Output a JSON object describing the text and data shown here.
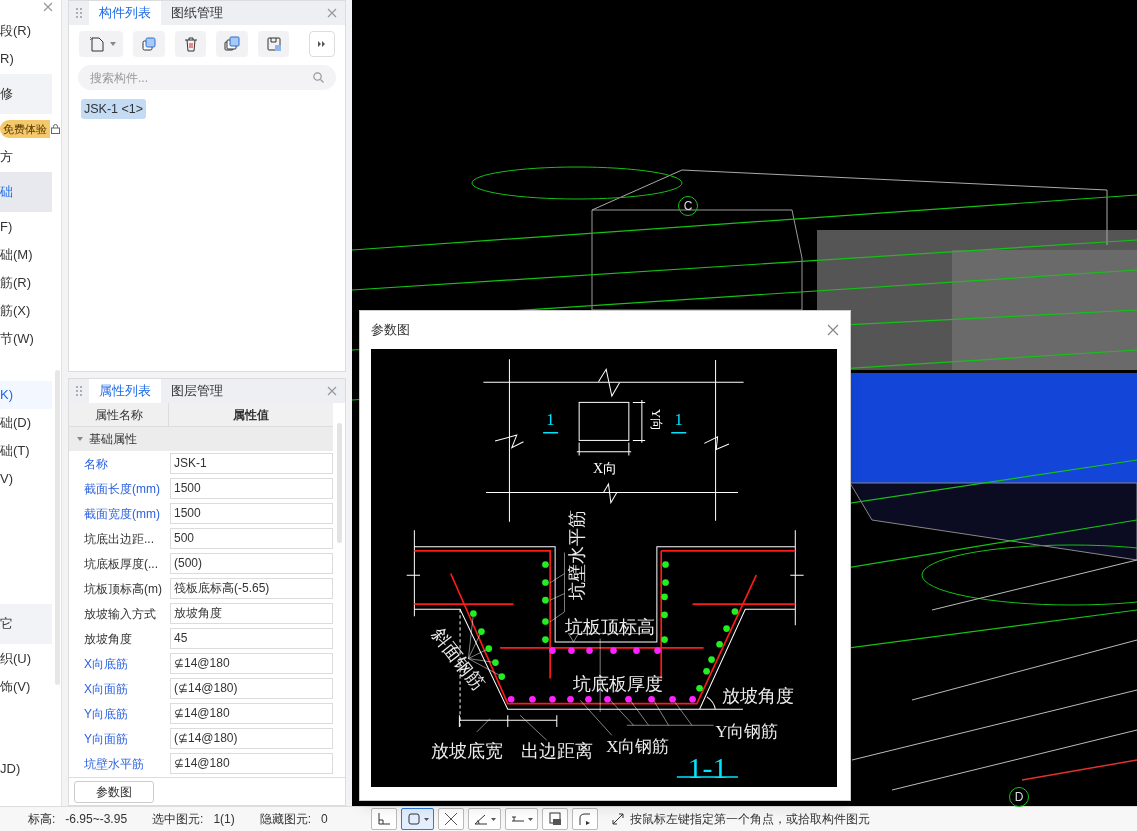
{
  "sidebar": {
    "trial_badge": "免费体验",
    "items": [
      {
        "label": "段(R)",
        "kind": "item",
        "selected": false
      },
      {
        "label": "R)",
        "kind": "item",
        "selected": false
      },
      {
        "label": "修",
        "kind": "group",
        "selected": false
      },
      {
        "label": "方",
        "kind": "item",
        "selected": false
      },
      {
        "label": "础",
        "kind": "group",
        "selected": true
      },
      {
        "label": "F)",
        "kind": "item",
        "selected": false
      },
      {
        "label": "础(M)",
        "kind": "item",
        "selected": false
      },
      {
        "label": "筋(R)",
        "kind": "item",
        "selected": false
      },
      {
        "label": "筋(X)",
        "kind": "item",
        "selected": false
      },
      {
        "label": "节(W)",
        "kind": "item",
        "selected": false
      },
      {
        "label": "K)",
        "kind": "item",
        "selected": true
      },
      {
        "label": "础(D)",
        "kind": "item",
        "selected": false
      },
      {
        "label": "础(T)",
        "kind": "item",
        "selected": false
      },
      {
        "label": "V)",
        "kind": "item",
        "selected": false
      },
      {
        "label": "它",
        "kind": "group",
        "selected": false
      },
      {
        "label": "织(U)",
        "kind": "item",
        "selected": false
      },
      {
        "label": "饰(V)",
        "kind": "item",
        "selected": false
      },
      {
        "label": "JD)",
        "kind": "item",
        "selected": false
      }
    ]
  },
  "component_panel": {
    "tabs": [
      {
        "label": "构件列表",
        "selected": true
      },
      {
        "label": "图纸管理",
        "selected": false
      }
    ],
    "search": {
      "placeholder": "搜索构件..."
    },
    "items": [
      {
        "label": "JSK-1 <1>",
        "selected": true
      }
    ]
  },
  "property_panel": {
    "tabs": [
      {
        "label": "属性列表",
        "selected": true
      },
      {
        "label": "图层管理",
        "selected": false
      }
    ],
    "columns": [
      "属性名称",
      "属性值"
    ],
    "groups": [
      {
        "label": "基础属性",
        "expanded": true,
        "rows": [
          {
            "name": "名称",
            "value": "JSK-1",
            "public": true
          },
          {
            "name": "截面长度(mm)",
            "value": "1500",
            "public": true
          },
          {
            "name": "截面宽度(mm)",
            "value": "1500",
            "public": true
          },
          {
            "name": "坑底出边距...",
            "value": "500",
            "public": false
          },
          {
            "name": "坑底板厚度(...",
            "value": "(500)",
            "public": false
          },
          {
            "name": "坑板顶标高(m)",
            "value": "筏板底标高(-5.65)",
            "public": false
          },
          {
            "name": "放坡输入方式",
            "value": "放坡角度",
            "public": false
          },
          {
            "name": "放坡角度",
            "value": "45",
            "public": false
          },
          {
            "name": "X向底筋",
            "value": "⊈14@180",
            "public": true
          },
          {
            "name": "X向面筋",
            "value": "(⊈14@180)",
            "public": true
          },
          {
            "name": "Y向底筋",
            "value": "⊈14@180",
            "public": true
          },
          {
            "name": "Y向面筋",
            "value": "(⊈14@180)",
            "public": true
          },
          {
            "name": "坑壁水平筋",
            "value": "⊈14@180",
            "public": true
          }
        ]
      }
    ],
    "button": "参数图"
  },
  "viewport": {
    "axis_labels": [
      "C",
      "D"
    ]
  },
  "dialog": {
    "title": "参数图",
    "plan": {
      "left_mark": "1",
      "right_mark": "1",
      "y_dim": "Y向",
      "x_dim": "X向"
    },
    "section": {
      "wall_rebar": "坑壁水平筋",
      "pit_top": "坑板顶标高",
      "slab_thickness": "坑底板厚度",
      "slope_angle": "放坡角度",
      "slope_rebar": "斜面钢筋",
      "y_rebar": "Y向钢筋",
      "slope_width": "放坡底宽",
      "edge_distance": "出边距离",
      "x_rebar": "X向钢筋",
      "title": "1-1"
    }
  },
  "status_bar": {
    "fields": [
      {
        "label": "标高:",
        "value": "-6.95~-3.95"
      },
      {
        "label": "选中图元:",
        "value": "1(1)"
      },
      {
        "label": "隐藏图元:",
        "value": "0"
      }
    ],
    "tools": [
      {
        "selected": false,
        "dropdown": false
      },
      {
        "selected": true,
        "dropdown": true
      },
      {
        "selected": false,
        "dropdown": false
      },
      {
        "selected": false,
        "dropdown": true
      },
      {
        "selected": false,
        "dropdown": true
      },
      {
        "selected": false,
        "dropdown": false
      },
      {
        "selected": false,
        "dropdown": false
      }
    ],
    "hint": "按鼠标左键指定第一个角点，或拾取构件图元"
  }
}
